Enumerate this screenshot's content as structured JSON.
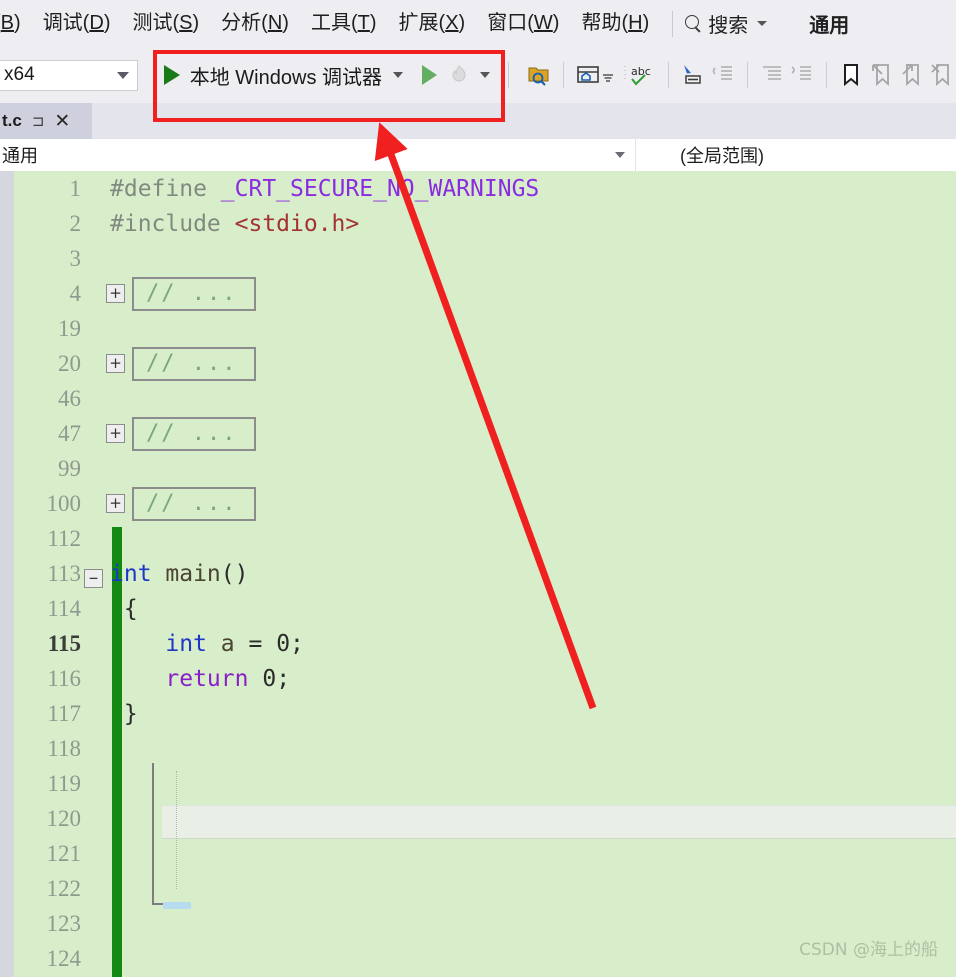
{
  "menubar": {
    "items": [
      {
        "label": "(B)",
        "mnemonic": "B",
        "truncated": true
      },
      {
        "label": "调试(D)",
        "mnemonic": "D"
      },
      {
        "label": "测试(S)",
        "mnemonic": "S"
      },
      {
        "label": "分析(N)",
        "mnemonic": "N"
      },
      {
        "label": "工具(T)",
        "mnemonic": "T"
      },
      {
        "label": "扩展(X)",
        "mnemonic": "X"
      },
      {
        "label": "窗口(W)",
        "mnemonic": "W"
      },
      {
        "label": "帮助(H)",
        "mnemonic": "H"
      }
    ],
    "search_label": "搜索",
    "search_icon": "search-icon",
    "general_label": "通用"
  },
  "toolbar": {
    "platform": "x64",
    "debugger_label": "本地 Windows 调试器",
    "run_icon": "play-filled-icon",
    "start_outline_icon": "play-outline-icon",
    "hot_reload_icon": "hot-reload-flame-icon",
    "icons": [
      "find-in-folder-icon",
      "window-home-icon",
      "spell-check-abc-icon",
      "comment-selection-icon",
      "uncomment-selection-icon",
      "decrease-indent-icon",
      "increase-indent-icon",
      "bookmark-icon",
      "previous-bookmark-icon",
      "next-bookmark-icon",
      "clear-bookmarks-icon"
    ]
  },
  "tab": {
    "title": "t.c",
    "pin_icon": "pin-icon",
    "close_icon": "close-icon"
  },
  "navbar": {
    "left_value": "通用",
    "right_value": "(全局范围)"
  },
  "editor": {
    "background_color": "#d8eeca",
    "change_bar_color": "#138a13",
    "current_line": 115,
    "lines": [
      {
        "num": "1",
        "segments": [
          {
            "t": "#define ",
            "c": "ppc"
          },
          {
            "t": "_CRT_SECURE_NO_WARNINGS",
            "c": "macro"
          }
        ]
      },
      {
        "num": "2",
        "segments": [
          {
            "t": "#include ",
            "c": "ppc"
          },
          {
            "t": "<stdio.h>",
            "c": "strred"
          }
        ]
      },
      {
        "num": "3",
        "segments": []
      },
      {
        "num": "4",
        "collapsed": true,
        "collapsed_text": "// ..."
      },
      {
        "num": "19",
        "segments": []
      },
      {
        "num": "20",
        "collapsed": true,
        "collapsed_text": "// ..."
      },
      {
        "num": "46",
        "segments": []
      },
      {
        "num": "47",
        "collapsed": true,
        "collapsed_text": "// ..."
      },
      {
        "num": "99",
        "segments": []
      },
      {
        "num": "100",
        "collapsed": true,
        "collapsed_text": "// ..."
      },
      {
        "num": "112",
        "segments": []
      },
      {
        "num": "113",
        "segments": [
          {
            "t": "int",
            "c": "kw-blue"
          },
          {
            "t": " main",
            "c": "plain"
          },
          {
            "t": "()",
            "c": "num"
          }
        ],
        "outline": "minus"
      },
      {
        "num": "114",
        "segments": [
          {
            "t": " {",
            "c": "num"
          }
        ]
      },
      {
        "num": "115",
        "segments": [
          {
            "t": "    ",
            "c": "plain"
          },
          {
            "t": "int",
            "c": "kw-blue"
          },
          {
            "t": " a ",
            "c": "plain"
          },
          {
            "t": "= ",
            "c": "num"
          },
          {
            "t": "0",
            "c": "num"
          },
          {
            "t": ";",
            "c": "num"
          }
        ],
        "current": true
      },
      {
        "num": "116",
        "segments": [
          {
            "t": "    ",
            "c": "plain"
          },
          {
            "t": "return",
            "c": "kw-purple"
          },
          {
            "t": " ",
            "c": "plain"
          },
          {
            "t": "0",
            "c": "num"
          },
          {
            "t": ";",
            "c": "num"
          }
        ]
      },
      {
        "num": "117",
        "segments": [
          {
            "t": " }",
            "c": "num"
          }
        ]
      },
      {
        "num": "118",
        "segments": []
      },
      {
        "num": "119",
        "segments": []
      },
      {
        "num": "120",
        "segments": []
      },
      {
        "num": "121",
        "segments": []
      },
      {
        "num": "122",
        "segments": []
      },
      {
        "num": "123",
        "segments": []
      },
      {
        "num": "124",
        "segments": []
      }
    ]
  },
  "watermark": "CSDN @海上的船",
  "annotations": {
    "highlight_color": "#f02020",
    "rect_label": "local-windows-debugger-highlight",
    "arrow_label": "pointer-arrow-to-debugger"
  }
}
